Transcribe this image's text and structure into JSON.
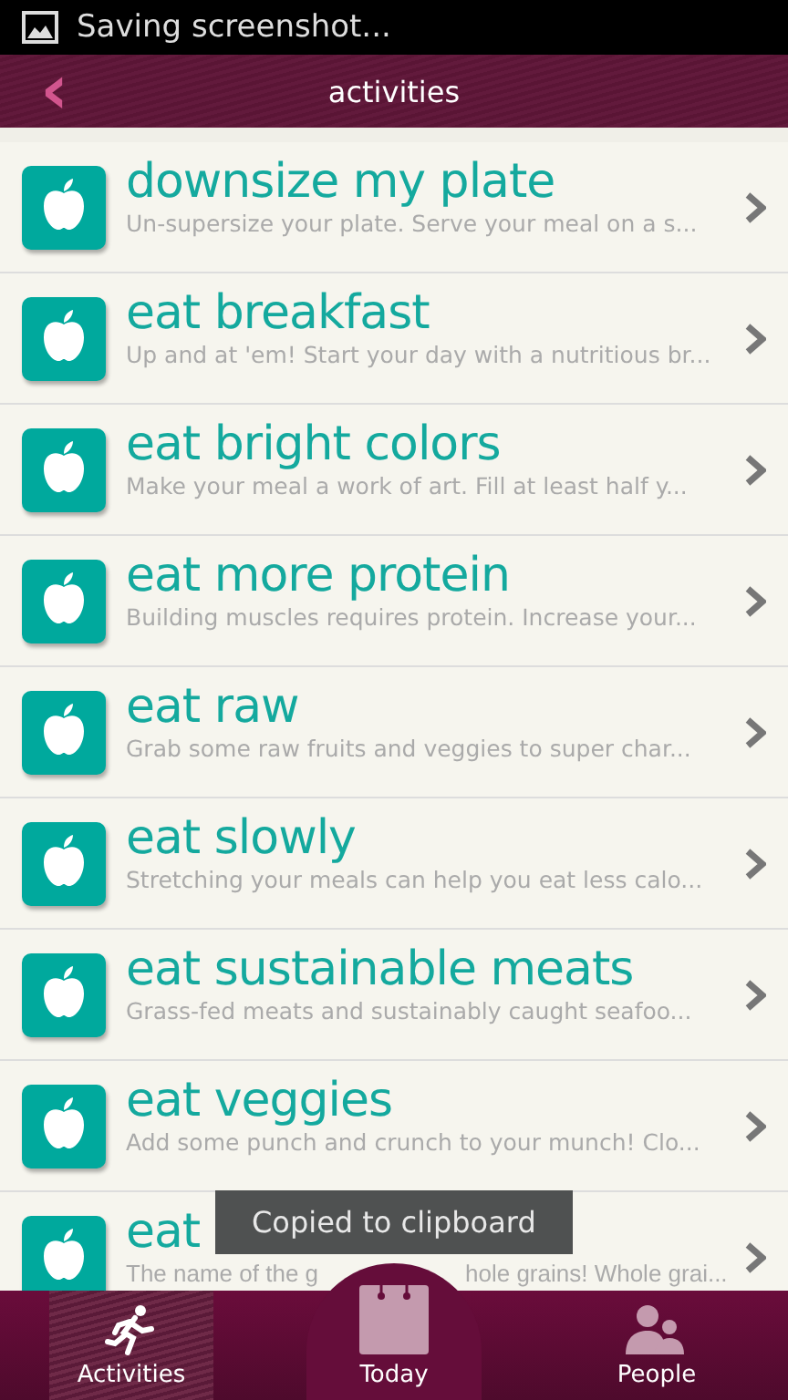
{
  "status_bar": {
    "notification": "Saving screenshot..."
  },
  "header": {
    "back": "‹",
    "title": "activities"
  },
  "activities": [
    {
      "title": "downsize my plate",
      "subtitle": "Un-supersize your plate. Serve your meal on a s..."
    },
    {
      "title": "eat breakfast",
      "subtitle": "Up and at 'em! Start your day with a nutritious br..."
    },
    {
      "title": "eat bright colors",
      "subtitle": "Make your meal a work of art. Fill at least half y..."
    },
    {
      "title": "eat more protein",
      "subtitle": "Building muscles requires protein. Increase your..."
    },
    {
      "title": "eat raw",
      "subtitle": "Grab some raw fruits and veggies to super char..."
    },
    {
      "title": "eat slowly",
      "subtitle": "Stretching your meals can help you eat less calo..."
    },
    {
      "title": "eat sustainable meats",
      "subtitle": "Grass-fed meats and sustainably caught seafoo..."
    },
    {
      "title": "eat veggies",
      "subtitle": "Add some punch and crunch to your munch! Clo..."
    },
    {
      "title": "eat",
      "subtitle_visible": [
        "The name of the g",
        "hole grains! Whole grai..."
      ]
    }
  ],
  "toast": "Copied to clipboard",
  "tabs": [
    {
      "label": "Activities",
      "kind": "runner",
      "selected": true
    },
    {
      "label": "Today",
      "kind": "calendar",
      "selected": false
    },
    {
      "label": "People",
      "kind": "people",
      "selected": false
    }
  ]
}
